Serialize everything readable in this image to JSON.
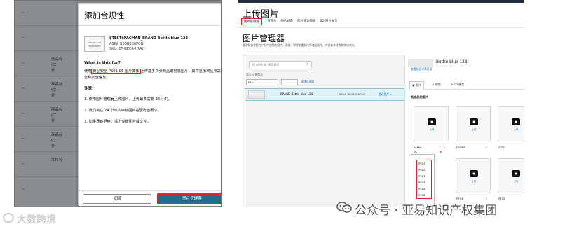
{
  "left": {
    "background_rows": [
      {
        "dash": "-",
        "lines": []
      },
      {
        "dash": "-",
        "lines": []
      },
      {
        "dash": "-",
        "lines": [
          "商品标",
          "(二",
          "条"
        ]
      },
      {
        "dash": "-",
        "lines": [
          "商品标",
          "(二",
          "条"
        ]
      },
      {
        "dash": "-",
        "lines": [
          "商品标",
          "(二",
          "条"
        ]
      },
      {
        "dash": "-",
        "lines": [
          "商品标",
          "(二",
          "条"
        ]
      },
      {
        "dash": "-",
        "lines": [
          "文件标"
        ]
      },
      {
        "dash": "-",
        "lines": []
      }
    ],
    "dialog": {
      "title": "添加合规性",
      "close_icon": "×",
      "product": {
        "image_placeholder": "Image not available",
        "name": "$TEST$PACMAN_BRAND Bottle blue 123",
        "asin": "ASIN: B00BB86PCG",
        "sku": "SKU: 1T-GECA-HPAH"
      },
      "what_is_this_heading": "What is this for?",
      "description_before": "使用",
      "description_highlight": "商品安全 PS01-06 图片变体",
      "description_after": "上传能多个张商品或包装图片，其中显示商品所需的警告和安全信息。",
      "notes_heading": "注意:",
      "notes": [
        "1. 使用图片管理器上传图片，上传最多需要 36 小时。",
        "2. 我们将在 24 小时内审核图片是否符合要求。",
        "3. 如果遇到拒绝，请上传新图片或文件。"
      ],
      "buttons": {
        "return": "返回",
        "image_manager": "图片管理器"
      }
    }
  },
  "right": {
    "page_title": "上传图片",
    "tabs": [
      {
        "label": "图片管理器",
        "active": true
      },
      {
        "label": "上传图片",
        "active": false
      },
      {
        "label": "图片状态",
        "active": false
      },
      {
        "label": "图片查询审核",
        "active": false
      },
      {
        "label": "3D 图片报告",
        "active": false
      }
    ],
    "manager_title": "图片管理器",
    "manager_subtitle": "管理和查看您在产品中使用的图片，添加、删除和重新排序商品图片，并查看其状态和审核状态。",
    "search_placeholder": "按 ASIN 或 SKU 搜索",
    "results_count": "显示 1 件商品",
    "filter_select": "SKU",
    "clear_filter": "清除过滤器",
    "result_row": {
      "name": "BRAND Bottle blue 123",
      "asin": "ASIN: B00BB86PCG",
      "action": "更改图片 ⌄"
    },
    "detail": {
      "title": "Bottle blue 123",
      "subtitle": "查看商品详情页面",
      "tabs": [
        {
          "label": "▣ 图片",
          "active": true
        },
        {
          "label": "⊙ 视频",
          "active": false
        },
        {
          "label": "⟳ 3D 模型",
          "active": false
        }
      ],
      "approved_label": "批准后的图片",
      "add_label": "上传",
      "slots_top": [
        {
          "label": "MAIN"
        },
        {
          "label": "FRONT"
        },
        {
          "label": "SIDE"
        }
      ],
      "slots_bottom": [
        {
          "label": ""
        },
        {
          "label": "PT04"
        },
        {
          "label": "PT05"
        }
      ],
      "dropdown_input": "PS",
      "dropdown_options": [
        "PS01",
        "PS02",
        "PS03",
        "PS04",
        "PS05",
        "PS06"
      ]
    }
  },
  "watermarks": {
    "left": "大数跨境",
    "right": "公众号 · 亚易知识产权集团"
  }
}
